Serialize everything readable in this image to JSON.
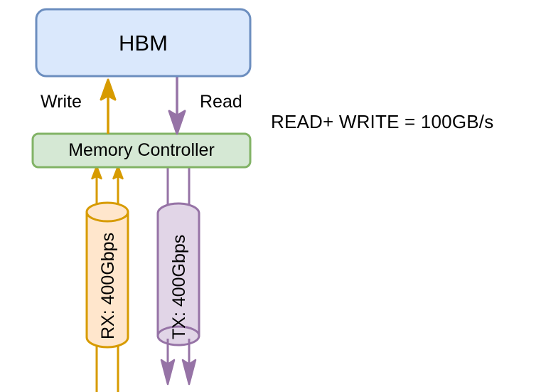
{
  "diagram": {
    "title_nodes": {
      "hbm": "HBM",
      "memory_controller": "Memory Controller"
    },
    "edges": {
      "write": "Write",
      "read": "Read"
    },
    "cylinders": {
      "rx": "RX: 400Gbps",
      "tx": "TX: 400Gbps"
    },
    "annotation": "READ+ WRITE = 100GB/s",
    "colors": {
      "hbm_fill": "#dae8fc",
      "hbm_stroke": "#6c8ebf",
      "mc_fill": "#d5e8d4",
      "mc_stroke": "#82b366",
      "rx_fill": "#ffe6cc",
      "rx_stroke": "#d79b00",
      "tx_fill": "#e1d5e7",
      "tx_stroke": "#9673a6",
      "text": "#000000",
      "background": "#ffffff"
    }
  }
}
